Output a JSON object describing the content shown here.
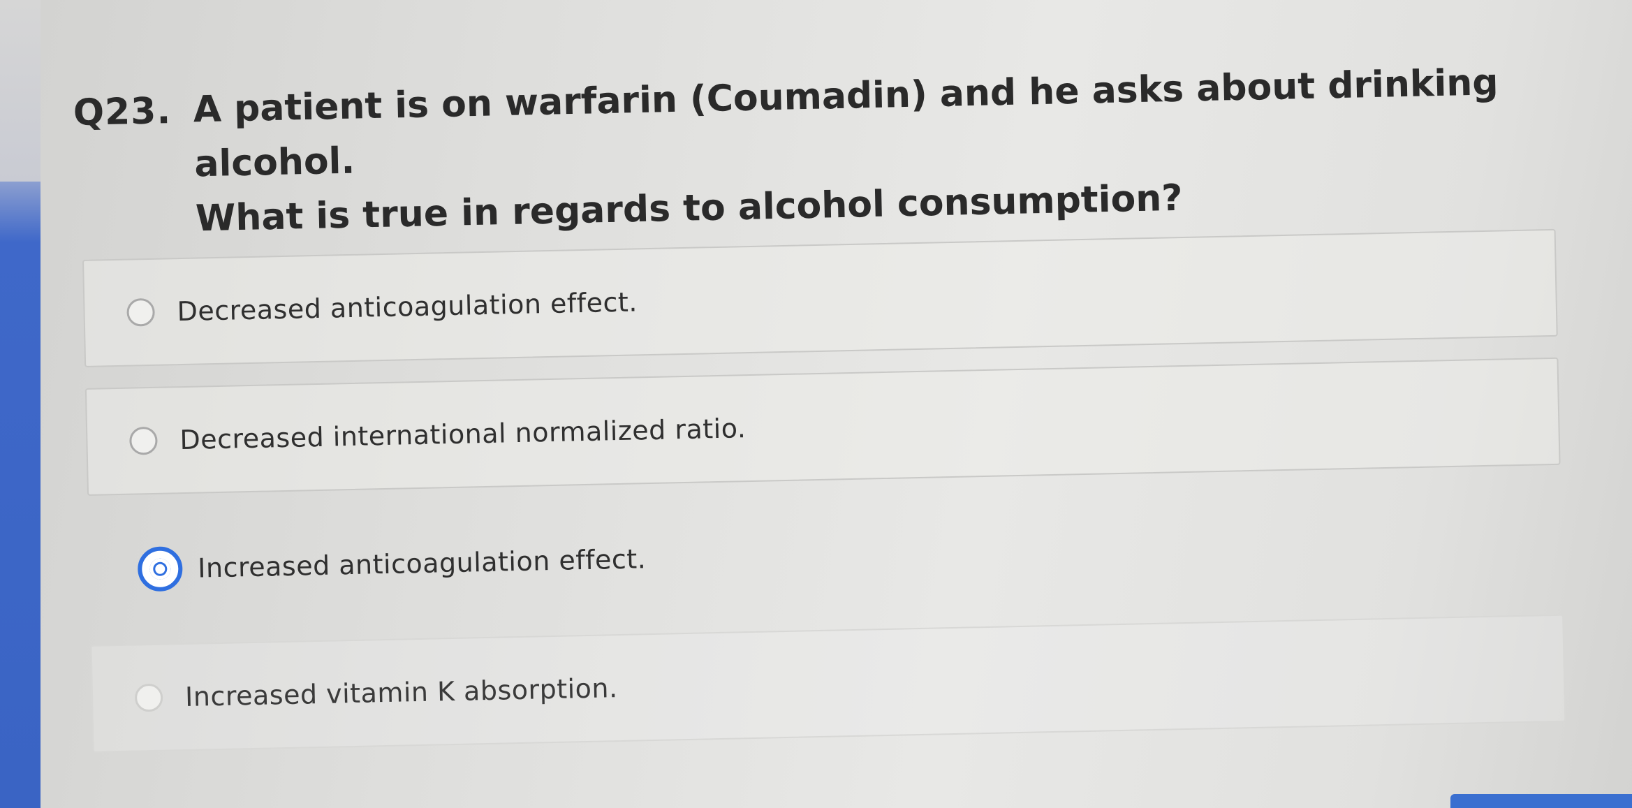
{
  "question": {
    "number": "Q23.",
    "line1": "A patient is on warfarin (Coumadin) and he asks about drinking alcohol.",
    "line2": "What is true in regards to alcohol consumption?"
  },
  "options": [
    {
      "label": "Decreased anticoagulation effect.",
      "selected": false
    },
    {
      "label": "Decreased international normalized ratio.",
      "selected": false
    },
    {
      "label": "Increased anticoagulation effect.",
      "selected": true
    },
    {
      "label": "Increased vitamin K absorption.",
      "selected": false
    }
  ],
  "colors": {
    "accent": "#2f6fe0",
    "page_background": "#e3e3e1",
    "left_edge": "#3a64c4"
  }
}
